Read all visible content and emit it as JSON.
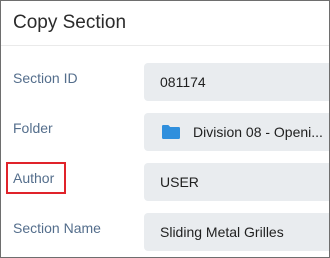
{
  "dialog": {
    "title": "Copy Section"
  },
  "fields": {
    "section_id": {
      "label": "Section ID",
      "value": "081174"
    },
    "folder": {
      "label": "Folder",
      "value": "Division 08 - Openi...",
      "icon": "folder-icon",
      "icon_color": "#2f8fdd"
    },
    "author": {
      "label": "Author",
      "value": "USER",
      "highlight_color": "#e0232a"
    },
    "section_name": {
      "label": "Section Name",
      "value": "Sliding Metal Grilles"
    }
  },
  "colors": {
    "label": "#546e8c",
    "field_background": "#e9ecef"
  }
}
